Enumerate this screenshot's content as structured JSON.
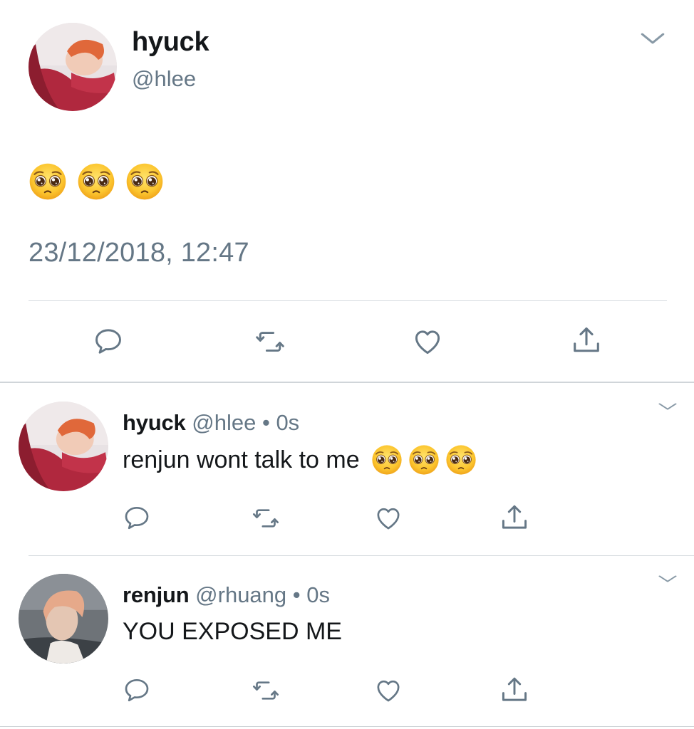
{
  "main_tweet": {
    "name": "hyuck",
    "handle": "@hlee",
    "content_emojis": [
      "pleading-face",
      "pleading-face",
      "pleading-face"
    ],
    "timestamp": "23/12/2018, 12:47",
    "actions": [
      "reply-icon",
      "retweet-icon",
      "like-icon",
      "share-icon"
    ]
  },
  "replies": [
    {
      "name": "hyuck",
      "handle": "@hlee",
      "separator": "•",
      "time": "0s",
      "text": "renjun wont talk to me",
      "emojis": [
        "pleading-face",
        "pleading-face",
        "pleading-face"
      ]
    },
    {
      "name": "renjun",
      "handle": "@rhuang",
      "separator": "•",
      "time": "0s",
      "text": "YOU EXPOSED ME",
      "emojis": []
    }
  ],
  "colors": {
    "primary_text": "#14171a",
    "secondary_text": "#657786",
    "icon": "#657786",
    "divider": "#d6dbdf",
    "avatar_hyuck": "#b0283e",
    "avatar_renjun": "#6e7378"
  }
}
